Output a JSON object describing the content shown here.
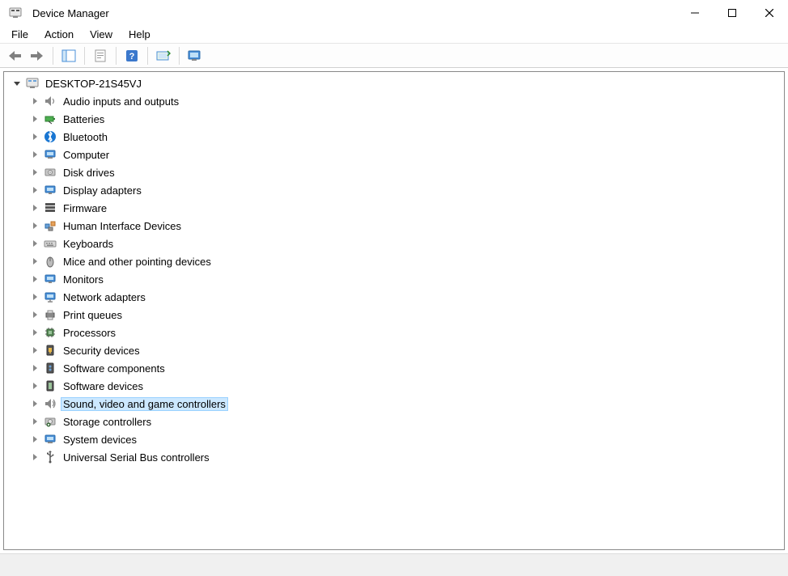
{
  "window": {
    "title": "Device Manager"
  },
  "menu": {
    "file": "File",
    "action": "Action",
    "view": "View",
    "help": "Help"
  },
  "toolbar": {
    "back": "Back",
    "forward": "Forward",
    "show_hide_tree": "Show/Hide Console Tree",
    "properties": "Properties",
    "help": "Help",
    "scan": "Scan for hardware changes",
    "monitor": "Show hidden devices"
  },
  "tree": {
    "root": {
      "label": "DESKTOP-21S45VJ",
      "icon": "pc"
    },
    "categories": [
      {
        "label": "Audio inputs and outputs",
        "icon": "audio"
      },
      {
        "label": "Batteries",
        "icon": "battery"
      },
      {
        "label": "Bluetooth",
        "icon": "bluetooth"
      },
      {
        "label": "Computer",
        "icon": "computer"
      },
      {
        "label": "Disk drives",
        "icon": "disk"
      },
      {
        "label": "Display adapters",
        "icon": "display"
      },
      {
        "label": "Firmware",
        "icon": "firmware"
      },
      {
        "label": "Human Interface Devices",
        "icon": "hid"
      },
      {
        "label": "Keyboards",
        "icon": "keyboard"
      },
      {
        "label": "Mice and other pointing devices",
        "icon": "mouse"
      },
      {
        "label": "Monitors",
        "icon": "monitor"
      },
      {
        "label": "Network adapters",
        "icon": "network"
      },
      {
        "label": "Print queues",
        "icon": "printer"
      },
      {
        "label": "Processors",
        "icon": "processor"
      },
      {
        "label": "Security devices",
        "icon": "security"
      },
      {
        "label": "Software components",
        "icon": "software-comp"
      },
      {
        "label": "Software devices",
        "icon": "software-dev"
      },
      {
        "label": "Sound, video and game controllers",
        "icon": "sound",
        "selected": true
      },
      {
        "label": "Storage controllers",
        "icon": "storage"
      },
      {
        "label": "System devices",
        "icon": "system"
      },
      {
        "label": "Universal Serial Bus controllers",
        "icon": "usb"
      }
    ]
  }
}
